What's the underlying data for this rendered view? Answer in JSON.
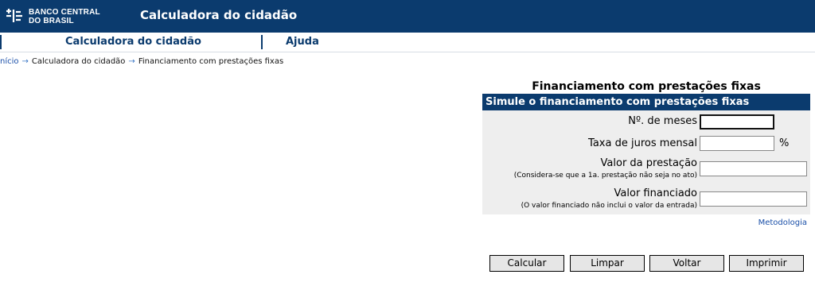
{
  "header": {
    "logo_line1": "BANCO CENTRAL",
    "logo_line2": "DO BRASIL",
    "title": "Calculadora do cidadão"
  },
  "nav": {
    "items": [
      {
        "label": "Calculadora do cidadão"
      },
      {
        "label": "Ajuda"
      }
    ]
  },
  "breadcrumb": {
    "home": "nício",
    "arrow": "→",
    "level1": "Calculadora do cidadão",
    "current": "Financiamento com prestações fixas"
  },
  "calculator": {
    "title": "Financiamento com prestações fixas",
    "header": "Simule o financiamento com prestações fixas",
    "fields": [
      {
        "label": "Nº. de meses",
        "value": "",
        "sublabel": ""
      },
      {
        "label": "Taxa de juros mensal",
        "value": "",
        "unit": "%",
        "sublabel": ""
      },
      {
        "label": "Valor da prestação",
        "value": "",
        "sublabel": "(Considera-se que a 1a. prestação não seja no ato)"
      },
      {
        "label": "Valor financiado",
        "value": "",
        "sublabel": "(O valor financiado não inclui o valor da entrada)"
      }
    ],
    "methodology_link": "Metodologia"
  },
  "buttons": {
    "calcular": "Calcular",
    "limpar": "Limpar",
    "voltar": "Voltar",
    "imprimir": "Imprimir"
  },
  "colors": {
    "brand_navy": "#0b3b6e",
    "link_blue": "#1a4fa8",
    "panel_bg": "#eeeeee"
  }
}
